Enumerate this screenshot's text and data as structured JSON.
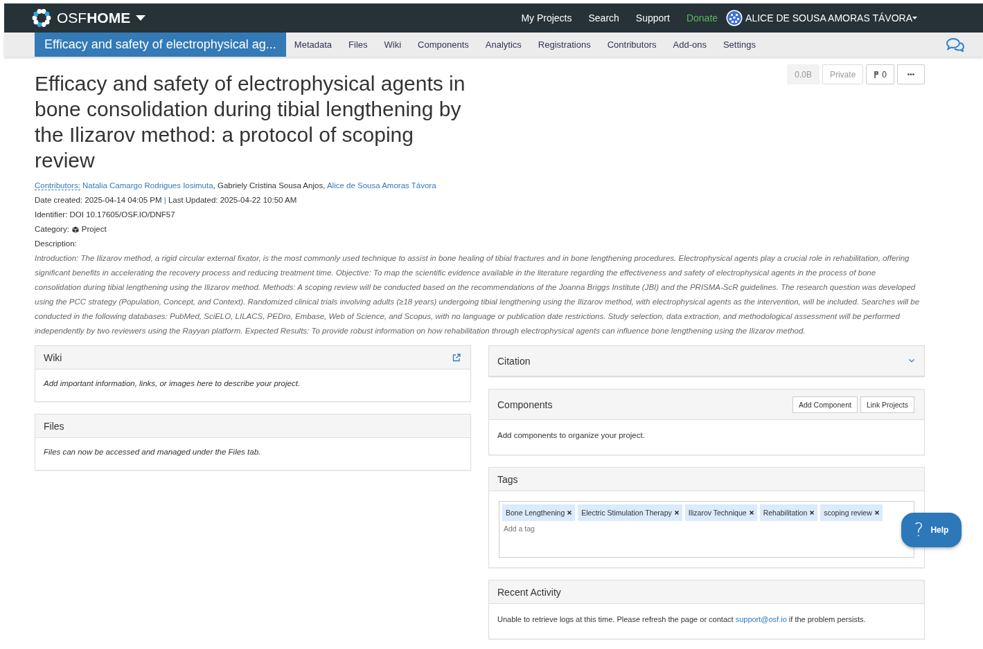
{
  "navbar": {
    "brand_prefix": "OSF",
    "brand_name": "HOME",
    "links": [
      {
        "label": "My Projects",
        "color": "#ffffff"
      },
      {
        "label": "Search",
        "color": "#ffffff"
      },
      {
        "label": "Support",
        "color": "#ffffff"
      },
      {
        "label": "Donate",
        "color": "#5cb85c"
      }
    ],
    "user": "ALICE DE SOUSA AMORAS TÁVORA"
  },
  "project_nav": {
    "tabs": [
      {
        "label": "Efficacy and safety of electrophysical ag...",
        "selected": true,
        "kind": "title"
      },
      {
        "label": "Metadata",
        "selected": false,
        "kind": "tab"
      },
      {
        "label": "Files",
        "selected": false,
        "kind": "tab"
      },
      {
        "label": "Wiki",
        "selected": false,
        "kind": "tab"
      },
      {
        "label": "Components",
        "selected": false,
        "kind": "tab"
      },
      {
        "label": "Analytics",
        "selected": false,
        "kind": "tab"
      },
      {
        "label": "Registrations",
        "selected": false,
        "kind": "tab"
      },
      {
        "label": "Contributors",
        "selected": false,
        "kind": "tab"
      },
      {
        "label": "Add-ons",
        "selected": false,
        "kind": "tab"
      },
      {
        "label": "Settings",
        "selected": false,
        "kind": "tab"
      }
    ]
  },
  "project": {
    "title": "Efficacy and safety of electrophysical agents in bone consolidation during tibial lengthening by the Ilizarov method: a protocol of scoping review",
    "size": "0.0B",
    "visibility": "Private",
    "forks": "0",
    "contributors_label": "Contributors:",
    "contributors": [
      {
        "name": "Natalia Camargo Rodrigues Iosimuta",
        "linked": true,
        "sep": ", "
      },
      {
        "name": "Gabriely Cristina Sousa Anjos",
        "linked": false,
        "sep": ", "
      },
      {
        "name": "Alice de Sousa Amoras Távora",
        "linked": true
      }
    ],
    "date_created": "Date created: 2025-04-14 04:05 PM",
    "date_sep": "|",
    "last_updated": "Last Updated: 2025-04-22 10:50 AM",
    "identifier": "Identifier: DOI 10.17605/OSF.IO/DNF57",
    "category_label": "Category:",
    "category": "Project",
    "description_label": "Description:",
    "description": "Introduction: The Ilizarov method, a rigid circular external fixator, is the most commonly used technique to assist in bone healing of tibial fractures and in bone lengthening procedures. Electrophysical agents play a crucial role in rehabilitation, offering significant benefits in accelerating the recovery process and reducing treatment time. Objective: To map the scientific evidence available in the literature regarding the effectiveness and safety of electrophysical agents in the process of bone consolidation during tibial lengthening using the Ilizarov method. Methods: A scoping review will be conducted based on the recommendations of the Joanna Briggs Institute (JBI) and the PRISMA-ScR guidelines. The research question was developed using the PCC strategy (Population, Concept, and Context). Randomized clinical trials involving adults (≥18 years) undergoing tibial lengthening using the Ilizarov method, with electrophysical agents as the intervention, will be included. Searches will be conducted in the following databases: PubMed, SciELO, LILACS, PEDro, Embase, Web of Science, and Scopus, with no language or publication date restrictions. Study selection, data extraction, and methodological assessment will be performed independently by two reviewers using the Rayyan platform. Expected Results: To provide robust information on how rehabilitation through electrophysical agents can influence bone lengthening using the Ilizarov method."
  },
  "wiki": {
    "title": "Wiki",
    "body": "Add important information, links, or images here to describe your project."
  },
  "files": {
    "title": "Files",
    "body": "Files can now be accessed and managed under the Files tab."
  },
  "citation": {
    "title": "Citation",
    "expanded": false
  },
  "components": {
    "title": "Components",
    "buttons": [
      "Add Component",
      "Link Projects"
    ],
    "body": "Add components to organize your project."
  },
  "tags": {
    "title": "Tags",
    "items": [
      "Bone Lengthening",
      "Electric Stimulation Therapy",
      "Ilizarov Technique",
      "Rehabilitation",
      "scoping review"
    ],
    "placeholder": "Add a tag"
  },
  "recent_activity": {
    "title": "Recent Activity",
    "message": "Unable to retrieve logs at this time. Please refresh the page or contact ",
    "link": "support@osf.io",
    "message_end": " if the problem persists."
  },
  "help": {
    "icon": "?",
    "label": "Help"
  }
}
